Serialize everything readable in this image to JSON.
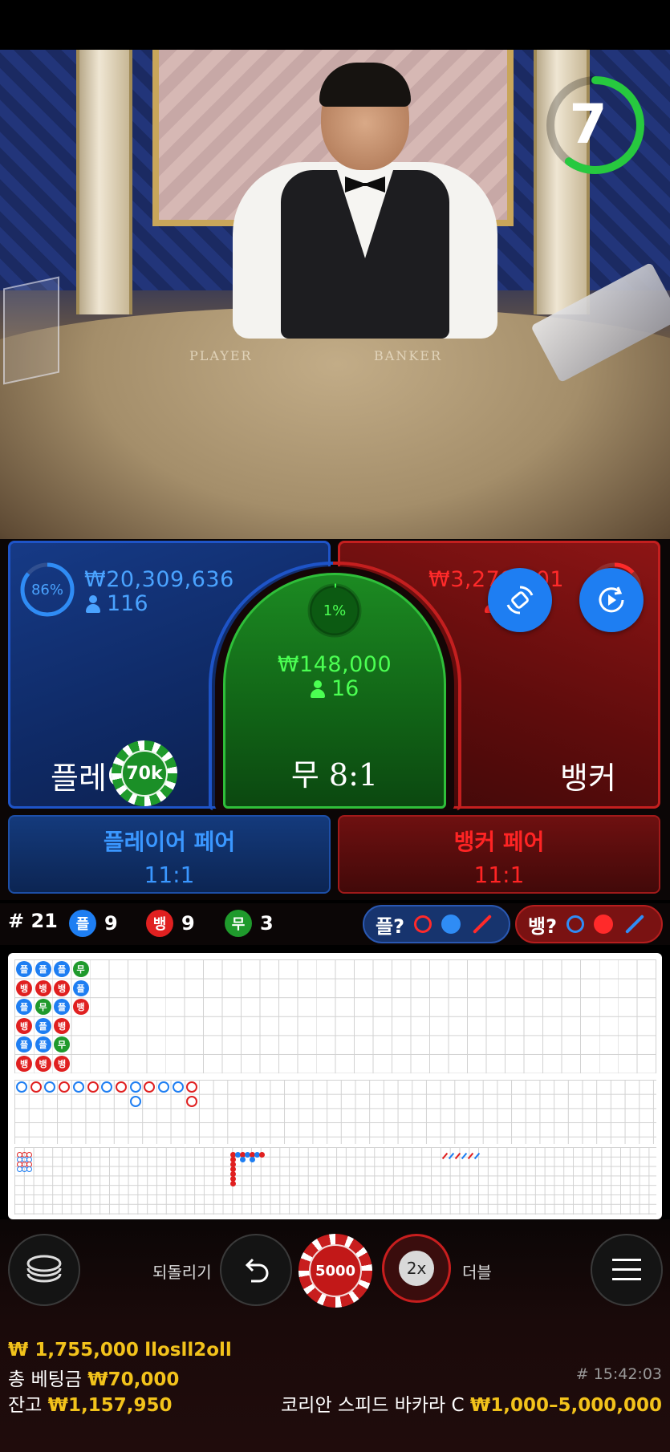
{
  "video": {
    "felt_player": "PLAYER",
    "felt_banker": "BANKER",
    "countdown": "7",
    "countdown_fraction": 0.6
  },
  "bets": {
    "player": {
      "percent_label": "86%",
      "percent_value": 0.86,
      "amount": "₩20,309,636",
      "players": "116",
      "title": "플레이어",
      "chip": "70k"
    },
    "tie": {
      "percent_label": "1%",
      "percent_value": 0.01,
      "amount": "₩148,000",
      "players": "16",
      "title": "무 8:1"
    },
    "banker": {
      "amount": "₩3,278,501",
      "players": "125",
      "title": "뱅커",
      "percent_value": 0.13
    },
    "player_pair": {
      "title": "플레이어 페어",
      "odds": "11:1"
    },
    "banker_pair": {
      "title": "뱅커 페어",
      "odds": "11:1"
    }
  },
  "stats": {
    "round": "# 21",
    "player_icon": "플",
    "player_count": "9",
    "banker_icon": "뱅",
    "banker_count": "9",
    "tie_icon": "무",
    "tie_count": "3",
    "player_predict": "플?",
    "banker_predict": "뱅?"
  },
  "roadmap": {
    "bead_columns": [
      [
        "플",
        "뱅",
        "플",
        "뱅",
        "플",
        "뱅"
      ],
      [
        "플",
        "뱅",
        "무",
        "플",
        "플",
        "뱅"
      ],
      [
        "플",
        "뱅",
        "플",
        "뱅",
        "무",
        "뱅"
      ],
      [
        "무",
        "플",
        "뱅"
      ]
    ]
  },
  "controls": {
    "undo_label": "되돌리기",
    "chip_value": "5000",
    "double_icon": "2x",
    "double_label": "더블"
  },
  "footer": {
    "winner_amount": "₩ 1,755,000",
    "winner_name": "llosll2oll",
    "total_bet_label": "총 베팅금",
    "total_bet": "₩70,000",
    "balance_label": "잔고",
    "balance": "₩1,157,950",
    "game_id": "# 15:42:03",
    "table_name": "코리안 스피드 바카라 C",
    "limits": "₩1,000–5,000,000"
  },
  "colors": {
    "player": "#1e7ef2",
    "banker": "#e02020",
    "tie": "#1f9a2c",
    "gold": "#f2c21b"
  }
}
